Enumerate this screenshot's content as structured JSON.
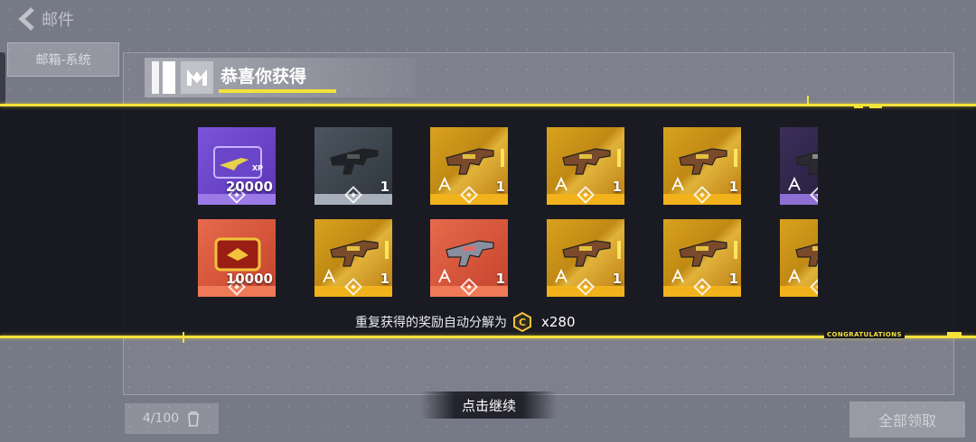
{
  "header": {
    "back_label": "邮件"
  },
  "sidebar": {
    "tab_label": "邮箱-系统"
  },
  "footer": {
    "count_label": "4/100",
    "claim_all_label": "全部领取"
  },
  "reward": {
    "title": "恭喜你获得",
    "banner_text": "CONGRATULATIONS",
    "duplicate_note": "重复获得的奖励自动分解为",
    "duplicate_amount": "x280",
    "continue_label": "点击继续"
  },
  "items_row1": [
    {
      "name": "xp-card",
      "qty": "20000",
      "rarity": "purple"
    },
    {
      "name": "grey-weapon",
      "qty": "1",
      "rarity": "grey"
    },
    {
      "name": "gold-weapon",
      "qty": "1",
      "rarity": "gold"
    },
    {
      "name": "gold-weapon",
      "qty": "1",
      "rarity": "gold"
    },
    {
      "name": "gold-weapon",
      "qty": "1",
      "rarity": "gold"
    },
    {
      "name": "purple-weapon",
      "qty": "",
      "rarity": "darkpurple"
    }
  ],
  "items_row2": [
    {
      "name": "credit-card",
      "qty": "10000",
      "rarity": "red"
    },
    {
      "name": "gold-weapon",
      "qty": "1",
      "rarity": "gold"
    },
    {
      "name": "red-weapon",
      "qty": "1",
      "rarity": "red"
    },
    {
      "name": "gold-weapon",
      "qty": "1",
      "rarity": "gold"
    },
    {
      "name": "gold-weapon",
      "qty": "1",
      "rarity": "gold"
    },
    {
      "name": "gold-weapon",
      "qty": "",
      "rarity": "gold"
    }
  ],
  "colors": {
    "accent": "#f4e13a",
    "gold": "#f2b21c",
    "purple": "#9b7ae8",
    "red": "#ef7a57"
  }
}
